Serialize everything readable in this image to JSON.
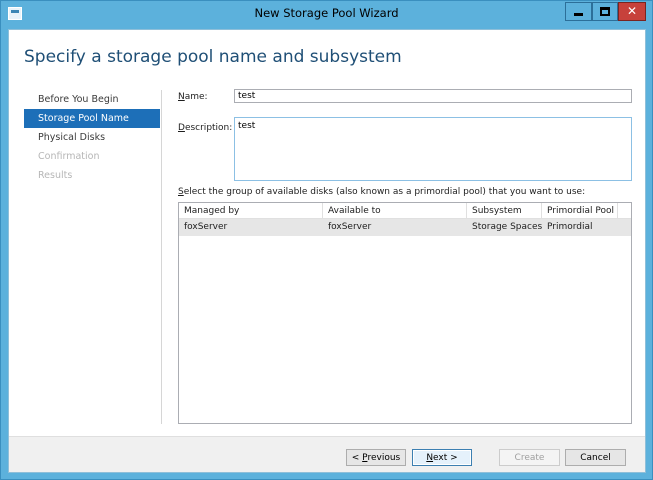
{
  "window": {
    "title": "New Storage Pool Wizard",
    "close_glyph": "✕"
  },
  "page_title": "Specify a storage pool name and subsystem",
  "nav": {
    "items": [
      {
        "label": "Before You Begin",
        "state": "enabled"
      },
      {
        "label": "Storage Pool Name",
        "state": "selected"
      },
      {
        "label": "Physical Disks",
        "state": "enabled"
      },
      {
        "label": "Confirmation",
        "state": "disabled"
      },
      {
        "label": "Results",
        "state": "disabled"
      }
    ]
  },
  "form": {
    "name_label_key": "N",
    "name_label_rest": "ame:",
    "name_value": "test",
    "description_label_key": "D",
    "description_label_rest": "escription:",
    "description_value": "test",
    "select_prompt_key": "S",
    "select_prompt_rest": "elect the group of available disks (also known as a primordial pool) that you want to use:"
  },
  "grid": {
    "columns": [
      "Managed by",
      "Available to",
      "Subsystem",
      "Primordial Pool"
    ],
    "rows": [
      [
        "foxServer",
        "foxServer",
        "Storage Spaces",
        "Primordial"
      ]
    ]
  },
  "buttons": {
    "previous_prefix": "< ",
    "previous_key": "P",
    "previous_rest": "revious",
    "next_key": "N",
    "next_rest": "ext >",
    "create": "Create",
    "cancel": "Cancel"
  },
  "colors": {
    "title_bar": "#5cb1dc",
    "selected_nav": "#1d6fb8",
    "heading": "#1f4f76",
    "close_button": "#c7413b"
  }
}
